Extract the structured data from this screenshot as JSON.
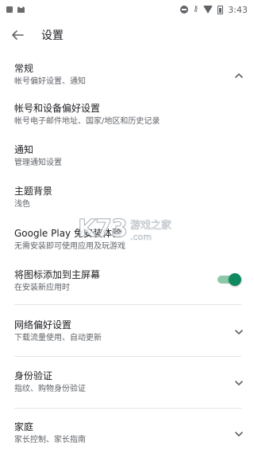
{
  "statusbar": {
    "time": "3:43"
  },
  "toolbar": {
    "title": "设置"
  },
  "items": [
    {
      "title": "常规",
      "subtitle": "帐号偏好设置、通知",
      "control": "chevron-up"
    },
    {
      "title": "帐号和设备偏好设置",
      "subtitle": "帐号电子邮件地址、国家/地区和历史记录"
    },
    {
      "title": "通知",
      "subtitle": "管理通知设置"
    },
    {
      "title": "主题背景",
      "subtitle": "浅色"
    },
    {
      "title": "Google Play 免安装体验",
      "subtitle": "无需安装即可使用应用及玩游戏"
    },
    {
      "title": "将图标添加到主屏幕",
      "subtitle": "在安装新应用时",
      "control": "toggle",
      "toggle_on": true
    },
    {
      "title": "网络偏好设置",
      "subtitle": "下载流量使用、自动更新",
      "control": "chevron-down"
    },
    {
      "title": "身份验证",
      "subtitle": "指纹、购物身份验证",
      "control": "chevron-down"
    },
    {
      "title": "家庭",
      "subtitle": "家长控制、家长指南",
      "control": "chevron-down"
    }
  ],
  "watermark": {
    "logo": "K73",
    "cn": "游戏之家",
    "domain": ".com"
  },
  "colors": {
    "accent": "#0f8a5f",
    "accent_track": "#8cc7a9",
    "text_primary": "#202124",
    "text_secondary": "#5f6368"
  },
  "icons": {
    "back": "arrow-left-icon",
    "expand": "chevron-up-icon",
    "collapse": "chevron-down-icon"
  }
}
